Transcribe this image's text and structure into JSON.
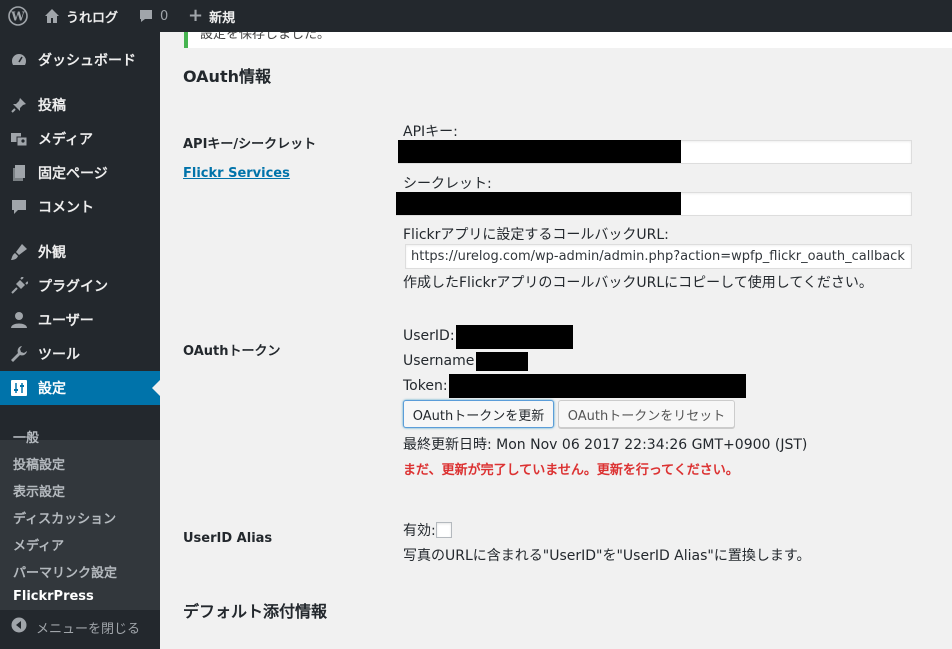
{
  "adminbar": {
    "wp_logo_icon": "wordpress-icon",
    "site_name": "うれログ",
    "comments_count": "0",
    "new_label": "新規"
  },
  "sidebar": {
    "items": [
      {
        "label": "ダッシュボード",
        "icon": "dashboard-icon"
      },
      {
        "label": "投稿",
        "icon": "pin-icon"
      },
      {
        "label": "メディア",
        "icon": "media-icon"
      },
      {
        "label": "固定ページ",
        "icon": "page-icon"
      },
      {
        "label": "コメント",
        "icon": "comment-icon"
      },
      {
        "label": "外観",
        "icon": "appearance-icon"
      },
      {
        "label": "プラグイン",
        "icon": "plugin-icon"
      },
      {
        "label": "ユーザー",
        "icon": "user-icon"
      },
      {
        "label": "ツール",
        "icon": "wrench-icon"
      },
      {
        "label": "設定",
        "icon": "settings-icon"
      }
    ],
    "submenu": [
      "一般",
      "投稿設定",
      "表示設定",
      "ディスカッション",
      "メディア",
      "パーマリンク設定",
      "FlickrPress"
    ],
    "collapse_label": "メニューを閉じる"
  },
  "main": {
    "notice_text": "設定を保存しました。",
    "oauth_section_title": "OAuth情報",
    "api_row": {
      "title": "APIキー/シークレット",
      "link": "Flickr Services",
      "api_key_label": "APIキー:",
      "secret_label": "シークレット:",
      "callback_label": "Flickrアプリに設定するコールバックURL:",
      "callback_url": "https://urelog.com/wp-admin/admin.php?action=wpfp_flickr_oauth_callback",
      "callback_help": "作成したFlickrアプリのコールバックURLにコピーして使用してください。"
    },
    "token_row": {
      "title": "OAuthトークン",
      "userid_label": "UserID:",
      "username_label": "Username:",
      "token_label": "Token:",
      "update_button": "OAuthトークンを更新",
      "reset_button": "OAuthトークンをリセット",
      "last_updated": "最終更新日時: Mon Nov 06 2017 22:34:26 GMT+0900 (JST)",
      "warning": "まだ、更新が完了していません。更新を行ってください。"
    },
    "alias_row": {
      "title": "UserID Alias",
      "enabled_label": "有効:",
      "help": "写真のURLに含まれる\"UserID\"を\"UserID Alias\"に置換します。"
    },
    "default_section_title": "デフォルト添付情報"
  },
  "colors": {
    "adminbar_bg": "#23282d",
    "accent": "#0073aa",
    "warning": "#dc3232",
    "notice_border": "#46b450"
  }
}
